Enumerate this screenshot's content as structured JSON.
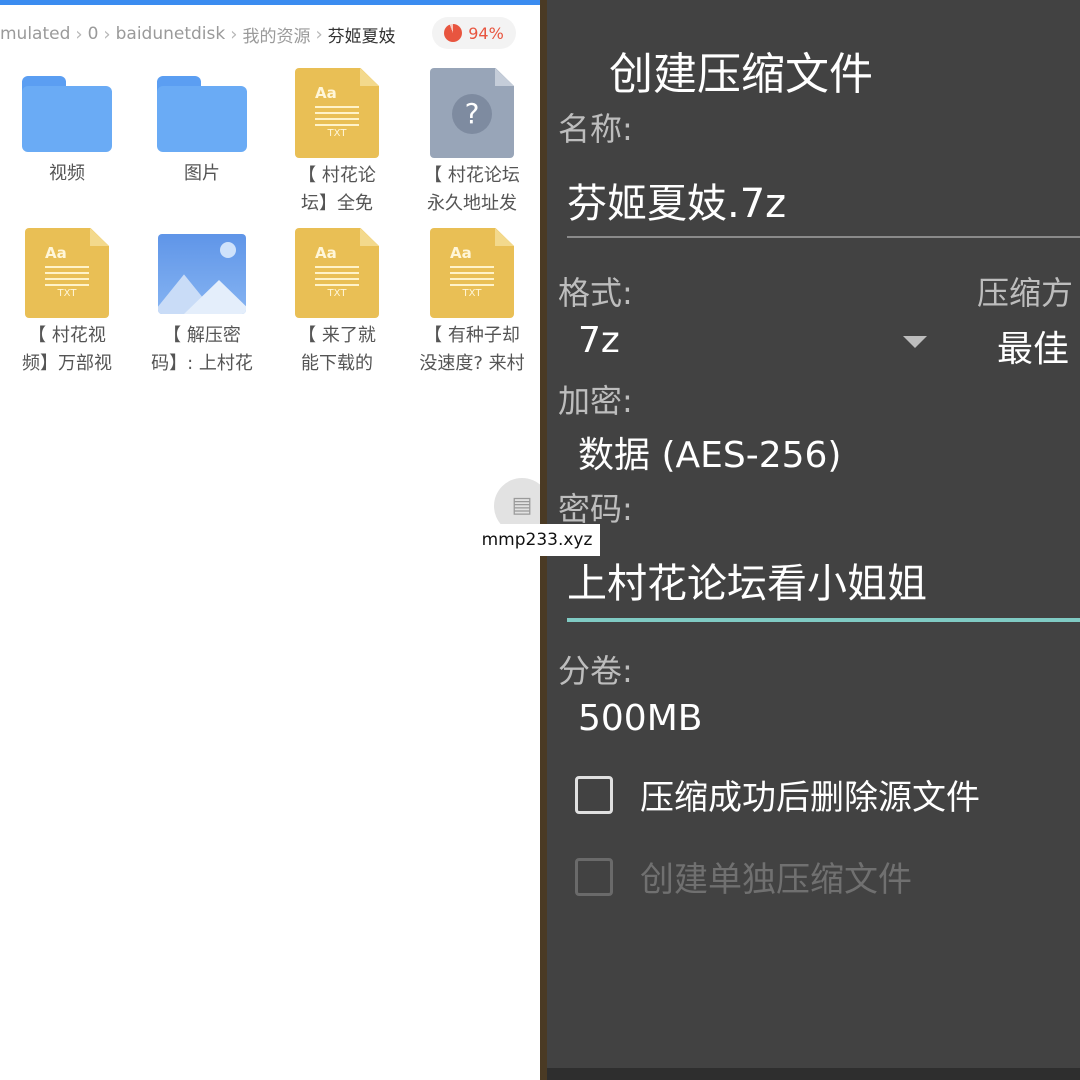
{
  "file_manager": {
    "breadcrumb": [
      "mulated",
      "0",
      "baidunetdisk",
      "我的资源",
      "芬姬夏妓"
    ],
    "storage_percent": "94%",
    "items": [
      {
        "type": "folder",
        "label_line1": "视频",
        "label_line2": ""
      },
      {
        "type": "folder",
        "label_line1": "图片",
        "label_line2": ""
      },
      {
        "type": "txt",
        "label_line1": "【 村花论",
        "label_line2": "坛】全免"
      },
      {
        "type": "unknown",
        "label_line1": "【 村花论坛",
        "label_line2": "永久地址发"
      },
      {
        "type": "txt",
        "label_line1": "【 村花视",
        "label_line2": "频】万部视"
      },
      {
        "type": "image",
        "label_line1": "【 解压密",
        "label_line2": "码】: 上村花"
      },
      {
        "type": "txt",
        "label_line1": "【 来了就",
        "label_line2": "能下载的"
      },
      {
        "type": "txt",
        "label_line1": "【 有种子却",
        "label_line2": "没速度? 来村"
      }
    ],
    "txt_icon": {
      "aa": "Aa",
      "ext": "TXT"
    },
    "unknown_icon": "?",
    "watermark": "mmp233.xyz"
  },
  "dialog": {
    "title": "创建压缩文件",
    "name_label": "名称:",
    "name_value": "芬姬夏妓.7z",
    "format_label": "格式:",
    "format_value": "7z",
    "method_label": "压缩方",
    "method_value": "最佳",
    "encryption_label": "加密:",
    "encryption_value": "数据 (AES-256)",
    "password_label": "密码:",
    "password_value": "上村花论坛看小姐姐",
    "volume_label": "分卷:",
    "volume_value": "500MB",
    "checkbox_delete_label": "压缩成功后删除源文件",
    "checkbox_separate_label": "创建单独压缩文件"
  },
  "colors": {
    "accent": "#80cbc4",
    "dialog_bg": "#424242",
    "folder": "#6aabf5",
    "txt_file": "#e9bf55",
    "storage": "#e8553f"
  }
}
